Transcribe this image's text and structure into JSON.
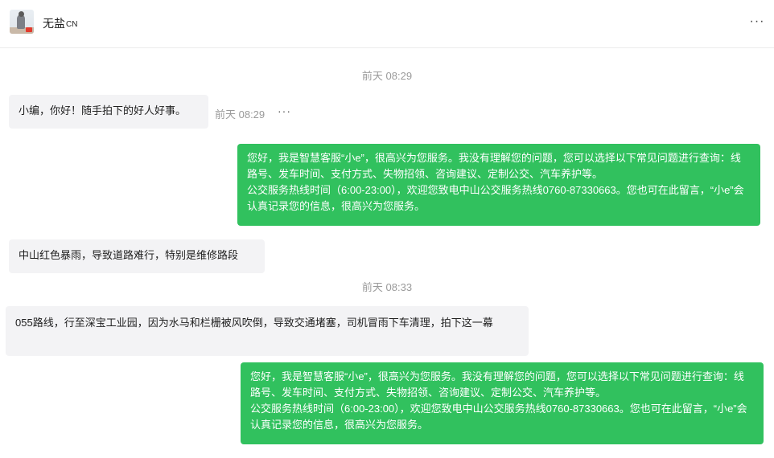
{
  "contact": {
    "name": "无盐",
    "name_suffix": "CN",
    "avatar_icon": "user-avatar"
  },
  "header": {
    "more_icon": "more-dots-icon",
    "more_glyph": "···"
  },
  "messages": [
    {
      "type": "time",
      "text": "前天 08:29"
    },
    {
      "type": "incoming",
      "text": "小编，你好！随手拍下的好人好事。",
      "time": "前天 08:29",
      "more_glyph": "···"
    },
    {
      "type": "outgoing",
      "text": "您好，我是智慧客服“小e”，很高兴为您服务。我没有理解您的问题，您可以选择以下常见问题进行查询：线路号、发车时间、支付方式、失物招领、咨询建议、定制公交、汽车养护等。\n公交服务热线时间（6:00-23:00），欢迎您致电中山公交服务热线0760-87330663。您也可在此留言，“小e”会认真记录您的信息，很高兴为您服务。"
    },
    {
      "type": "incoming",
      "text": "中山红色暴雨，导致道路难行，特别是维修路段"
    },
    {
      "type": "time",
      "text": "前天 08:33"
    },
    {
      "type": "incoming",
      "text": "055路线，行至深宝工业园，因为水马和栏栅被风吹倒，导致交通堵塞，司机冒雨下车清理，拍下这一幕"
    },
    {
      "type": "outgoing",
      "text": "您好，我是智慧客服“小e”，很高兴为您服务。我没有理解您的问题，您可以选择以下常见问题进行查询：线路号、发车时间、支付方式、失物招领、咨询建议、定制公交、汽车养护等。\n公交服务热线时间（6:00-23:00），欢迎您致电中山公交服务热线0760-87330663。您也可在此留言，“小e”会认真记录您的信息，很高兴为您服务。"
    }
  ],
  "colors": {
    "outgoing_bubble": "#31c15e",
    "incoming_bubble": "#f3f3f5",
    "timestamp": "#9a9a9a"
  }
}
